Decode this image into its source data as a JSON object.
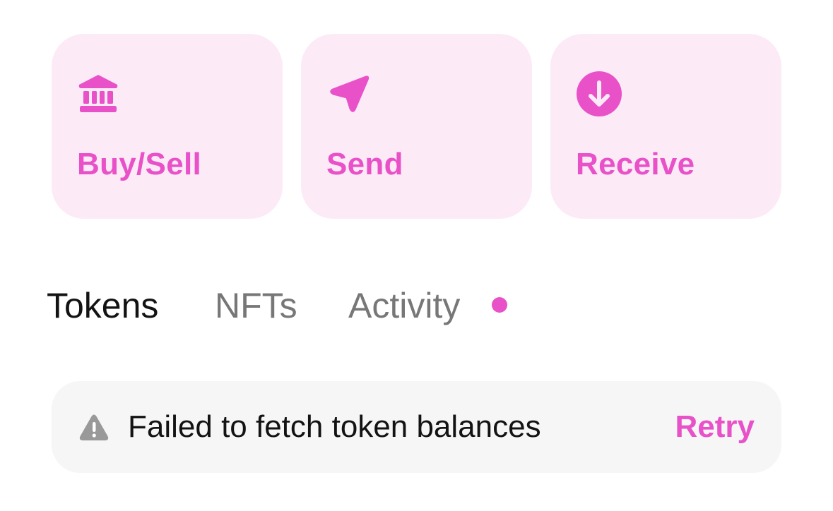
{
  "theme": {
    "accent": "#e951c9",
    "card_bg": "#fcebf7",
    "text_primary": "#131313",
    "text_secondary": "#777777",
    "banner_bg": "#f6f6f6",
    "warning_icon": "#999999"
  },
  "actions": [
    {
      "label": "Buy/Sell",
      "icon": "bank-icon"
    },
    {
      "label": "Send",
      "icon": "paper-plane-icon"
    },
    {
      "label": "Receive",
      "icon": "arrow-down-circle-icon"
    }
  ],
  "tabs": [
    {
      "label": "Tokens",
      "active": true
    },
    {
      "label": "NFTs",
      "active": false
    },
    {
      "label": "Activity",
      "active": false,
      "has_notification_dot": true
    }
  ],
  "error_banner": {
    "icon": "warning-icon",
    "message": "Failed to fetch token balances",
    "action_label": "Retry"
  }
}
